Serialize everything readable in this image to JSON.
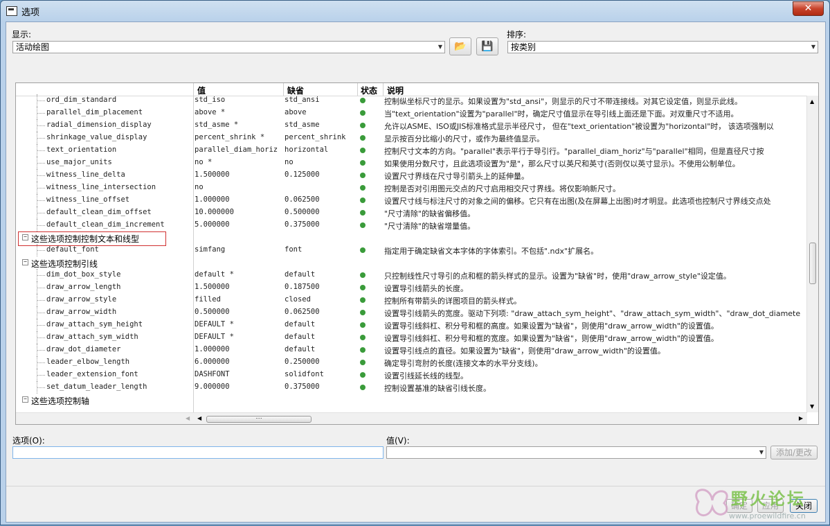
{
  "window": {
    "title": "选项",
    "close_label": "✕"
  },
  "display": {
    "label": "显示:",
    "value": "活动绘图"
  },
  "sort": {
    "label": "排序:",
    "value": "按类别"
  },
  "grid": {
    "headers": {
      "value": "值",
      "default": "缺省",
      "status": "状态",
      "description": "说明"
    },
    "rows": [
      {
        "name": "ord_dim_standard",
        "value": "std_iso",
        "default": "std_ansi",
        "desc": "控制纵坐标尺寸的显示。如果设置为\"std_ansi\"，则显示的尺寸不带连接线。对其它设定值，则显示此线。"
      },
      {
        "name": "parallel_dim_placement",
        "value": "above *",
        "default": "above",
        "desc": "当\"text_orientation\"设置为\"parallel\"时，确定尺寸值显示在导引线上面还是下面。对双重尺寸不适用。"
      },
      {
        "name": "radial_dimension_display",
        "value": "std_asme *",
        "default": "std_asme",
        "desc": "允许以ASME、ISO或JIS标准格式显示半径尺寸， 但在\"text_orientation\"被设置为\"horizontal\"时， 该选项强制以"
      },
      {
        "name": "shrinkage_value_display",
        "value": "percent_shrink *",
        "default": "percent_shrink",
        "desc": "显示按百分比缩小的尺寸，或作为最终值显示。"
      },
      {
        "name": "text_orientation",
        "value": "parallel_diam_horiz",
        "default": "horizontal",
        "desc": "控制尺寸文本的方向。\"parallel\"表示平行于导引行。\"parallel_diam_horiz\"与\"parallel\"相同，但是直径尺寸按"
      },
      {
        "name": "use_major_units",
        "value": "no *",
        "default": "no",
        "desc": "如果使用分数尺寸，且此选项设置为\"是\"，那么尺寸以英尺和英寸(否则仅以英寸显示)。不使用公制单位。"
      },
      {
        "name": "witness_line_delta",
        "value": "1.500000",
        "default": "0.125000",
        "desc": "设置尺寸界线在尺寸导引箭头上的延伸量。"
      },
      {
        "name": "witness_line_intersection",
        "value": "no",
        "default": "",
        "desc": "控制是否对引用图元交点的尺寸启用相交尺寸界线。将仅影响新尺寸。"
      },
      {
        "name": "witness_line_offset",
        "value": "1.000000",
        "default": "0.062500",
        "desc": "设置尺寸线与标注尺寸的对象之间的偏移。它只有在出图(及在屏幕上出图)时才明显。此选项也控制尺寸界线交点处"
      },
      {
        "name": "default_clean_dim_offset",
        "value": "10.000000",
        "default": "0.500000",
        "desc": "\"尺寸清除\"的缺省偏移值。"
      },
      {
        "name": "default_clean_dim_increment",
        "value": "5.000000",
        "default": "0.375000",
        "desc": "\"尺寸清除\"的缺省增量值。"
      },
      {
        "group": "这些选项控制控制文本和线型"
      },
      {
        "name": "default_font",
        "value": "simfang",
        "default": "font",
        "desc": "指定用于确定缺省文本字体的字体索引。不包括\".ndx\"扩展名。"
      },
      {
        "group": "这些选项控制引线"
      },
      {
        "name": "dim_dot_box_style",
        "value": "default *",
        "default": "default",
        "desc": "只控制线性尺寸导引的点和框的箭头样式的显示。设置为\"缺省\"时，使用\"draw_arrow_style\"设定值。"
      },
      {
        "name": "draw_arrow_length",
        "value": "1.500000",
        "default": "0.187500",
        "desc": "设置导引线箭头的长度。"
      },
      {
        "name": "draw_arrow_style",
        "value": "filled",
        "default": "closed",
        "desc": "控制所有带箭头的详图项目的箭头样式。"
      },
      {
        "name": "draw_arrow_width",
        "value": "0.500000",
        "default": "0.062500",
        "desc": "设置导引线箭头的宽度。驱动下列项: \"draw_attach_sym_height\"、\"draw_attach_sym_width\"、\"draw_dot_diamete"
      },
      {
        "name": "draw_attach_sym_height",
        "value": "DEFAULT *",
        "default": "default",
        "desc": "设置导引线斜杠、积分号和框的高度。如果设置为\"缺省\"，则使用\"draw_arrow_width\"的设置值。"
      },
      {
        "name": "draw_attach_sym_width",
        "value": "DEFAULT *",
        "default": "default",
        "desc": "设置导引线斜杠、积分号和框的宽度。如果设置为\"缺省\"，则使用\"draw_arrow_width\"的设置值。"
      },
      {
        "name": "draw_dot_diameter",
        "value": "1.000000",
        "default": "default",
        "desc": "设置导引线点的直径。如果设置为\"缺省\"，则使用\"draw_arrow_width\"的设置值。"
      },
      {
        "name": "leader_elbow_length",
        "value": "6.000000",
        "default": "0.250000",
        "desc": "确定导引弯肘的长度(连接文本的水平分支线)。"
      },
      {
        "name": "leader_extension_font",
        "value": "DASHFONT",
        "default": "solidfont",
        "desc": "设置引线延长线的线型。"
      },
      {
        "name": "set_datum_leader_length",
        "value": "9.000000",
        "default": "0.375000",
        "desc": "控制设置基准的缺省引线长度。"
      },
      {
        "group": "这些选项控制轴"
      }
    ]
  },
  "option_field": {
    "label": "选项(O):",
    "value": ""
  },
  "value_field": {
    "label": "值(V):",
    "value": ""
  },
  "buttons": {
    "add_change": "添加/更改",
    "ok": "确定",
    "apply": "应用",
    "close": "关闭"
  },
  "watermark": {
    "title": "野火论坛",
    "url": "www.proewildfire.cn"
  },
  "colors": {
    "status_dot": "#3a9b3a",
    "highlight_border": "#d03030",
    "title_bar": "#b9d1ea"
  }
}
